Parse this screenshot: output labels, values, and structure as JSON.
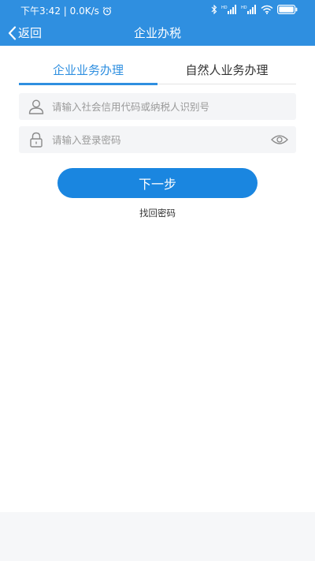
{
  "status_bar": {
    "time_speed": "下午3:42 | 0.0K/s",
    "sim1": "HD",
    "sim2": "HD"
  },
  "header": {
    "back_label": "返回",
    "title": "企业办税"
  },
  "tabs": [
    {
      "label": "企业业务办理",
      "active": true
    },
    {
      "label": "自然人业务办理",
      "active": false
    }
  ],
  "form": {
    "account_placeholder": "请输入社会信用代码或纳税人识别号",
    "password_placeholder": "请输入登录密码",
    "account_value": "",
    "password_value": ""
  },
  "actions": {
    "next_label": "下一步",
    "forgot_label": "找回密码"
  },
  "colors": {
    "primary": "#2f8fe0",
    "button": "#1a86e0",
    "field_bg": "#f4f5f7"
  }
}
